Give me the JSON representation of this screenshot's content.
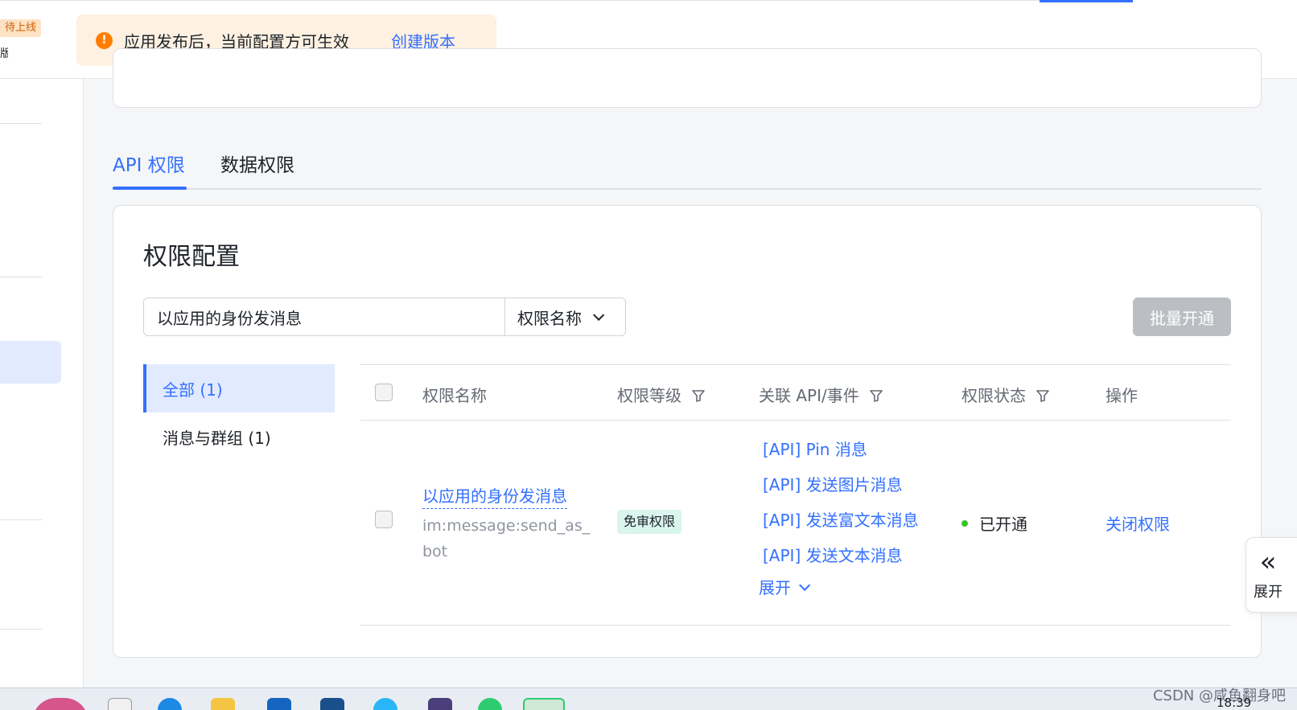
{
  "header": {
    "status_badge": "待上线",
    "truncated_text": "版",
    "notice_message": "应用发布后，当前配置方可生效",
    "notice_link": "创建版本"
  },
  "tabs": [
    {
      "label": "API 权限",
      "active": true
    },
    {
      "label": "数据权限",
      "active": false
    }
  ],
  "permission_card": {
    "title": "权限配置",
    "search": {
      "value": "以应用的身份发消息",
      "placeholder": ""
    },
    "search_field_select": "权限名称",
    "bulk_button": "批量开通"
  },
  "categories": [
    {
      "label": "全部 (1)",
      "active": true
    },
    {
      "label": "消息与群组 (1)",
      "active": false
    }
  ],
  "table": {
    "columns": [
      "权限名称",
      "权限等级",
      "关联 API/事件",
      "权限状态",
      "操作"
    ],
    "rows": [
      {
        "name": "以应用的身份发消息",
        "code": "im:message:send_as_bot",
        "level": "免审权限",
        "apis": [
          "[API] Pin 消息",
          "[API] 发送图片消息",
          "[API] 发送富文本消息",
          "[API] 发送文本消息"
        ],
        "expand_label": "展开",
        "status": "已开通",
        "action": "关闭权限"
      }
    ]
  },
  "float_panel": {
    "label": "展开"
  },
  "taskbar": {
    "time": "18:39",
    "watermark": "CSDN @咸鱼翻身吧"
  },
  "colors": {
    "primary": "#3370ff",
    "warning": "#ff7d00",
    "success": "#34c724",
    "disabled": "#bbbfc4"
  }
}
